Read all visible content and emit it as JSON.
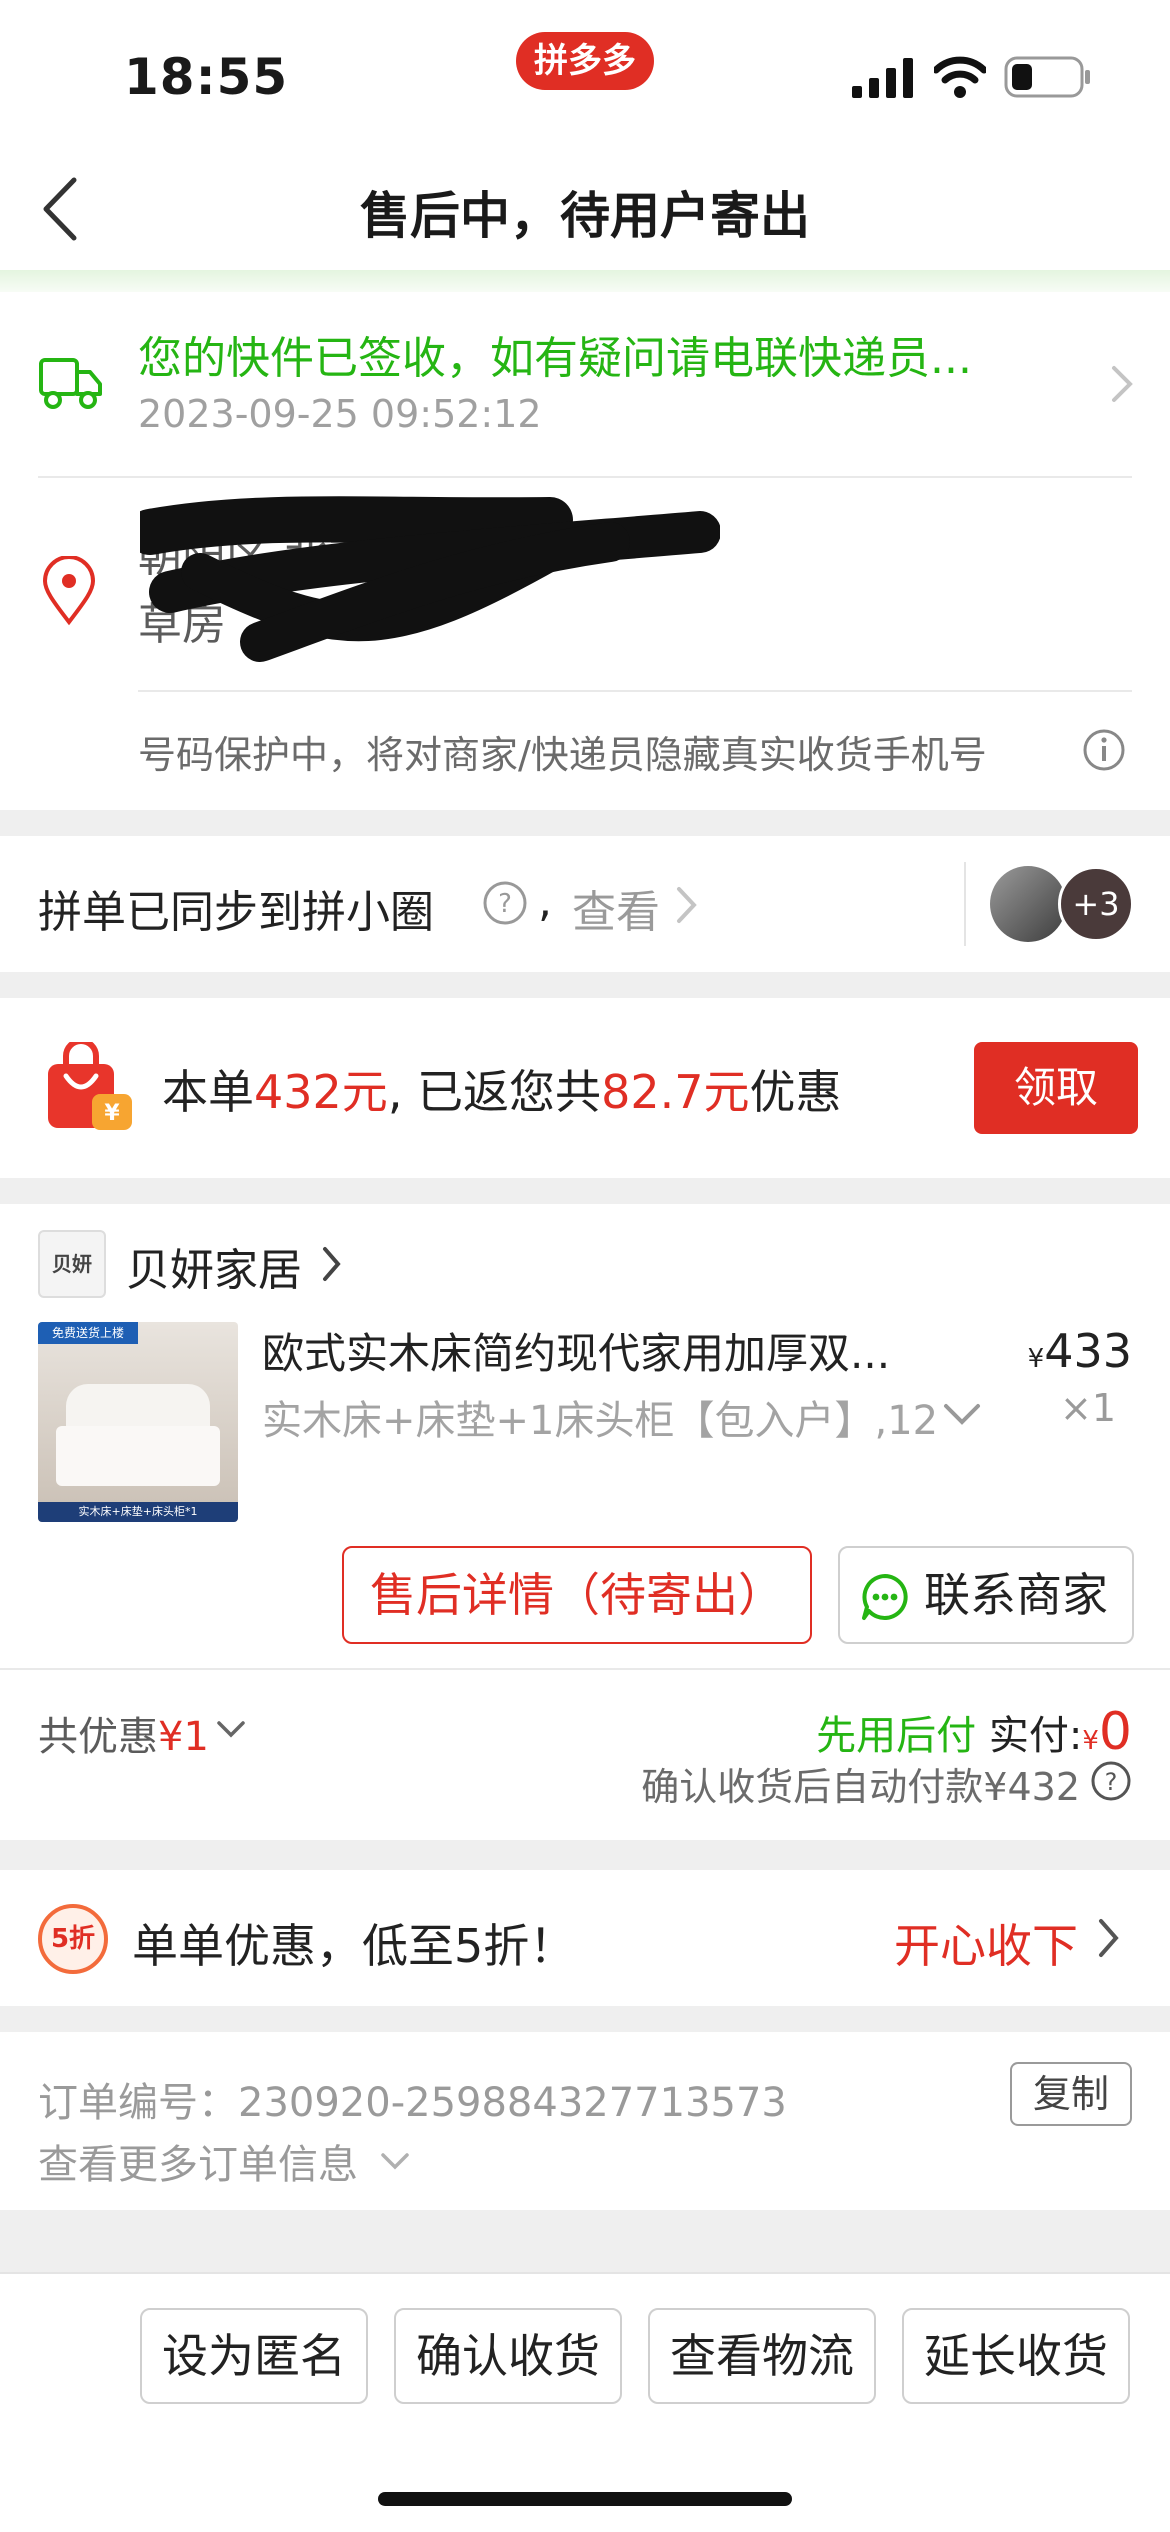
{
  "status_bar": {
    "time": "18:55",
    "app_badge": "拼多多"
  },
  "nav": {
    "back_icon": "chevron-left-icon",
    "title": "售后中，待用户寄出"
  },
  "tracking": {
    "status": "您的快件已签收，如有疑问请电联快递员...",
    "time": "2023-09-25 09:52:12",
    "address_line1": "朝阳区 北京市朝阳区",
    "address_line2": "草房",
    "privacy_note": "号码保护中，将对商家/快递员隐藏真实收货手机号"
  },
  "sync": {
    "text": "拼单已同步到拼小圈",
    "comma": ",",
    "view_label": "查看",
    "extra_count": "+3"
  },
  "rebate": {
    "prefix": "本单",
    "amount": "432元",
    "middle": ", 已返您共",
    "saved": "82.7元",
    "suffix": "优惠",
    "claim_label": "领取"
  },
  "order": {
    "store_logo_text": "贝妍",
    "store_name": "贝妍家居",
    "thumb_badge": "免费送货上楼",
    "thumb_caption": "实木床+床垫+床头柜*1",
    "product_title": "欧式实木床简约现代家用加厚双...",
    "product_spec": "实木床+床垫+1床头柜【包入户】,12",
    "currency_symbol": "¥",
    "price": "433",
    "quantity": "×1",
    "aftersale_label": "售后详情（待寄出）",
    "contact_label": "联系商家",
    "discount_label": "共优惠",
    "discount_value": "¥1",
    "pay_later": "先用后付",
    "paid_label": "实付:",
    "paid_currency": "¥",
    "paid_value": "0",
    "auto_pay_note": "确认收货后自动付款¥432"
  },
  "promo": {
    "badge": "5折",
    "text": "单单优惠，低至5折！",
    "action": "开心收下"
  },
  "order_info": {
    "order_no_label": "订单编号：",
    "order_no": "230920-259884327713573",
    "copy_label": "复制",
    "more_label": "查看更多订单信息"
  },
  "bottom_actions": [
    "设为匿名",
    "确认收货",
    "查看物流",
    "延长收货"
  ],
  "colors": {
    "brand_red": "#e02e24",
    "accent_green": "#25b513"
  }
}
